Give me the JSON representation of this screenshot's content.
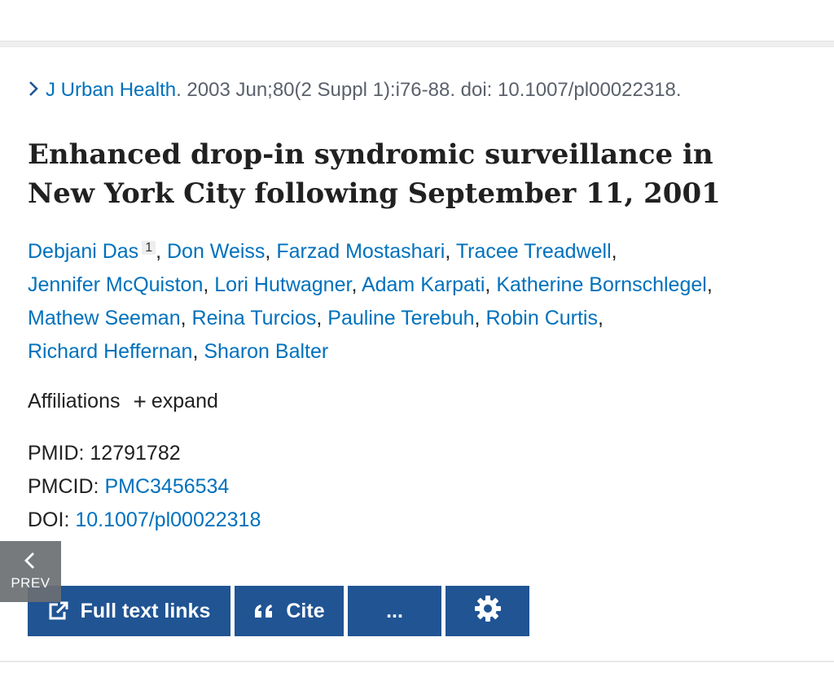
{
  "citation": {
    "journal": "J Urban Health",
    "details": ". 2003 Jun;80(2 Suppl 1):i76-88. doi: 10.1007/pl00022318."
  },
  "article": {
    "title": "Enhanced drop-in syndromic surveillance in New York City following September 11, 2001",
    "authors": [
      "Debjani Das",
      "Don Weiss",
      "Farzad Mostashari",
      "Tracee Treadwell",
      "Jennifer McQuiston",
      "Lori Hutwagner",
      "Adam Karpati",
      "Katherine Bornschlegel",
      "Mathew Seeman",
      "Reina Turcios",
      "Pauline Terebuh",
      "Robin Curtis",
      "Richard Heffernan",
      "Sharon Balter"
    ],
    "first_author_affil_number": "1"
  },
  "affiliations": {
    "label": "Affiliations",
    "expand": "expand"
  },
  "identifiers": {
    "pmid_label": "PMID:",
    "pmid": "12791782",
    "pmcid_label": "PMCID:",
    "pmcid": "PMC3456534",
    "doi_label": "DOI:",
    "doi": "10.1007/pl00022318"
  },
  "nav": {
    "prev": "PREV"
  },
  "actions": {
    "full_text": "Full text links",
    "cite": "Cite",
    "more": "...",
    "settings_icon": "gear-icon"
  },
  "colors": {
    "link": "#0071bc",
    "button": "#205493",
    "prev_bg": "#6b6f73"
  }
}
